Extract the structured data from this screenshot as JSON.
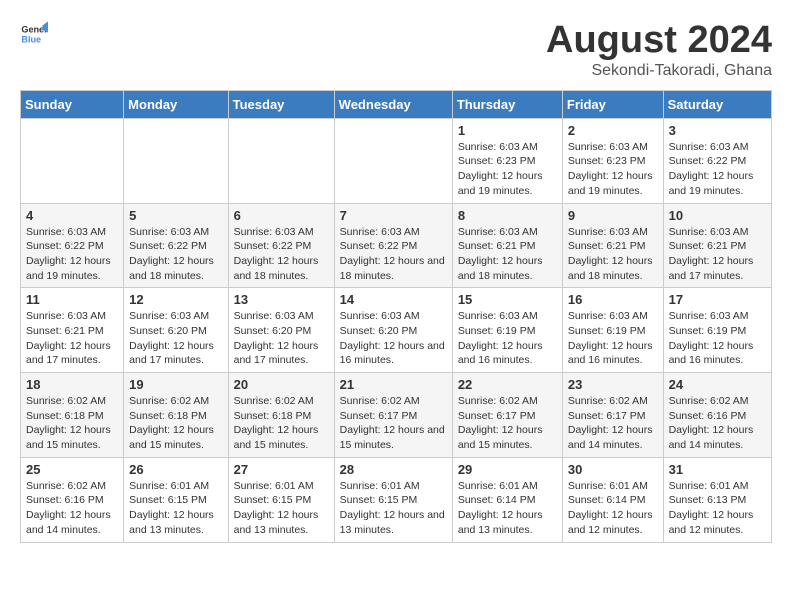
{
  "header": {
    "logo": {
      "general": "General",
      "blue": "Blue"
    },
    "title": "August 2024",
    "location": "Sekondi-Takoradi, Ghana"
  },
  "calendar": {
    "weekdays": [
      "Sunday",
      "Monday",
      "Tuesday",
      "Wednesday",
      "Thursday",
      "Friday",
      "Saturday"
    ],
    "weeks": [
      [
        {
          "day": "",
          "info": ""
        },
        {
          "day": "",
          "info": ""
        },
        {
          "day": "",
          "info": ""
        },
        {
          "day": "",
          "info": ""
        },
        {
          "day": "1",
          "info": "Sunrise: 6:03 AM\nSunset: 6:23 PM\nDaylight: 12 hours and 19 minutes."
        },
        {
          "day": "2",
          "info": "Sunrise: 6:03 AM\nSunset: 6:23 PM\nDaylight: 12 hours and 19 minutes."
        },
        {
          "day": "3",
          "info": "Sunrise: 6:03 AM\nSunset: 6:22 PM\nDaylight: 12 hours and 19 minutes."
        }
      ],
      [
        {
          "day": "4",
          "info": "Sunrise: 6:03 AM\nSunset: 6:22 PM\nDaylight: 12 hours and 19 minutes."
        },
        {
          "day": "5",
          "info": "Sunrise: 6:03 AM\nSunset: 6:22 PM\nDaylight: 12 hours and 18 minutes."
        },
        {
          "day": "6",
          "info": "Sunrise: 6:03 AM\nSunset: 6:22 PM\nDaylight: 12 hours and 18 minutes."
        },
        {
          "day": "7",
          "info": "Sunrise: 6:03 AM\nSunset: 6:22 PM\nDaylight: 12 hours and 18 minutes."
        },
        {
          "day": "8",
          "info": "Sunrise: 6:03 AM\nSunset: 6:21 PM\nDaylight: 12 hours and 18 minutes."
        },
        {
          "day": "9",
          "info": "Sunrise: 6:03 AM\nSunset: 6:21 PM\nDaylight: 12 hours and 18 minutes."
        },
        {
          "day": "10",
          "info": "Sunrise: 6:03 AM\nSunset: 6:21 PM\nDaylight: 12 hours and 17 minutes."
        }
      ],
      [
        {
          "day": "11",
          "info": "Sunrise: 6:03 AM\nSunset: 6:21 PM\nDaylight: 12 hours and 17 minutes."
        },
        {
          "day": "12",
          "info": "Sunrise: 6:03 AM\nSunset: 6:20 PM\nDaylight: 12 hours and 17 minutes."
        },
        {
          "day": "13",
          "info": "Sunrise: 6:03 AM\nSunset: 6:20 PM\nDaylight: 12 hours and 17 minutes."
        },
        {
          "day": "14",
          "info": "Sunrise: 6:03 AM\nSunset: 6:20 PM\nDaylight: 12 hours and 16 minutes."
        },
        {
          "day": "15",
          "info": "Sunrise: 6:03 AM\nSunset: 6:19 PM\nDaylight: 12 hours and 16 minutes."
        },
        {
          "day": "16",
          "info": "Sunrise: 6:03 AM\nSunset: 6:19 PM\nDaylight: 12 hours and 16 minutes."
        },
        {
          "day": "17",
          "info": "Sunrise: 6:03 AM\nSunset: 6:19 PM\nDaylight: 12 hours and 16 minutes."
        }
      ],
      [
        {
          "day": "18",
          "info": "Sunrise: 6:02 AM\nSunset: 6:18 PM\nDaylight: 12 hours and 15 minutes."
        },
        {
          "day": "19",
          "info": "Sunrise: 6:02 AM\nSunset: 6:18 PM\nDaylight: 12 hours and 15 minutes."
        },
        {
          "day": "20",
          "info": "Sunrise: 6:02 AM\nSunset: 6:18 PM\nDaylight: 12 hours and 15 minutes."
        },
        {
          "day": "21",
          "info": "Sunrise: 6:02 AM\nSunset: 6:17 PM\nDaylight: 12 hours and 15 minutes."
        },
        {
          "day": "22",
          "info": "Sunrise: 6:02 AM\nSunset: 6:17 PM\nDaylight: 12 hours and 15 minutes."
        },
        {
          "day": "23",
          "info": "Sunrise: 6:02 AM\nSunset: 6:17 PM\nDaylight: 12 hours and 14 minutes."
        },
        {
          "day": "24",
          "info": "Sunrise: 6:02 AM\nSunset: 6:16 PM\nDaylight: 12 hours and 14 minutes."
        }
      ],
      [
        {
          "day": "25",
          "info": "Sunrise: 6:02 AM\nSunset: 6:16 PM\nDaylight: 12 hours and 14 minutes."
        },
        {
          "day": "26",
          "info": "Sunrise: 6:01 AM\nSunset: 6:15 PM\nDaylight: 12 hours and 13 minutes."
        },
        {
          "day": "27",
          "info": "Sunrise: 6:01 AM\nSunset: 6:15 PM\nDaylight: 12 hours and 13 minutes."
        },
        {
          "day": "28",
          "info": "Sunrise: 6:01 AM\nSunset: 6:15 PM\nDaylight: 12 hours and 13 minutes."
        },
        {
          "day": "29",
          "info": "Sunrise: 6:01 AM\nSunset: 6:14 PM\nDaylight: 12 hours and 13 minutes."
        },
        {
          "day": "30",
          "info": "Sunrise: 6:01 AM\nSunset: 6:14 PM\nDaylight: 12 hours and 12 minutes."
        },
        {
          "day": "31",
          "info": "Sunrise: 6:01 AM\nSunset: 6:13 PM\nDaylight: 12 hours and 12 minutes."
        }
      ]
    ]
  }
}
